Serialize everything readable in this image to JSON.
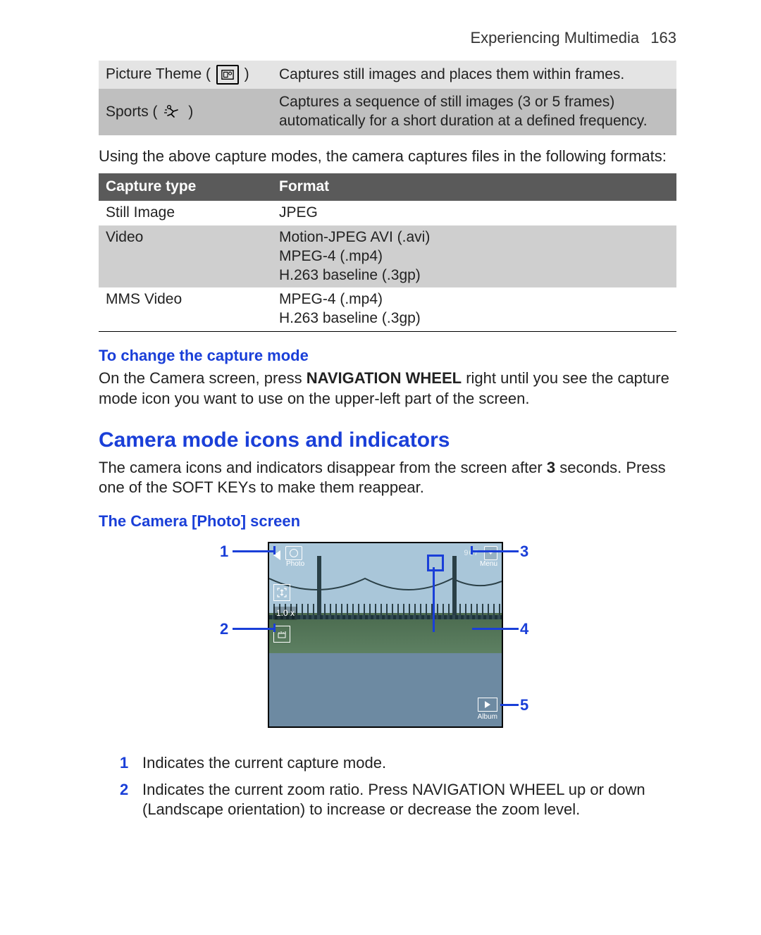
{
  "header": {
    "section": "Experiencing Multimedia",
    "page": "163"
  },
  "modes_table": {
    "rows": [
      {
        "label": "Picture Theme",
        "desc": "Captures still images and places them within frames."
      },
      {
        "label": "Sports",
        "desc": "Captures a sequence of still images (3 or 5 frames) automatically for a short duration at a defined frequency."
      }
    ]
  },
  "intro_para": "Using the above capture modes, the camera captures files in the following formats:",
  "formats_table": {
    "head": {
      "c1": "Capture type",
      "c2": "Format"
    },
    "rows": [
      {
        "c1": "Still Image",
        "c2": "JPEG"
      },
      {
        "c1": "Video",
        "c2": "Motion-JPEG AVI (.avi)\nMPEG-4 (.mp4)\nH.263 baseline (.3gp)"
      },
      {
        "c1": "MMS Video",
        "c2": "MPEG-4 (.mp4)\nH.263 baseline (.3gp)"
      }
    ]
  },
  "change_mode": {
    "title": "To change the capture mode",
    "body_pre": "On the Camera screen, press ",
    "body_bold": "NAVIGATION WHEEL",
    "body_post": " right until you see the capture mode icon you want to use on the upper-left part of the screen."
  },
  "section_h2": "Camera mode icons and indicators",
  "section_body_pre": "The camera icons and indicators disappear from the screen after ",
  "section_body_bold": "3",
  "section_body_post": " seconds. Press one of the SOFT KEYs to make them reappear.",
  "photo_screen_title": "The Camera [Photo] screen",
  "hud": {
    "photo_label": "Photo",
    "zoom": "1.0 x",
    "remaining": "967",
    "menu": "Menu",
    "album": "Album"
  },
  "callouts": {
    "n1": "1",
    "n2": "2",
    "n3": "3",
    "n4": "4",
    "n5": "5"
  },
  "legend": [
    {
      "n": "1",
      "t": "Indicates the current capture mode."
    },
    {
      "n": "2",
      "t": "Indicates the current zoom ratio. Press NAVIGATION WHEEL up or down (Landscape orientation) to increase or decrease the zoom level."
    }
  ]
}
